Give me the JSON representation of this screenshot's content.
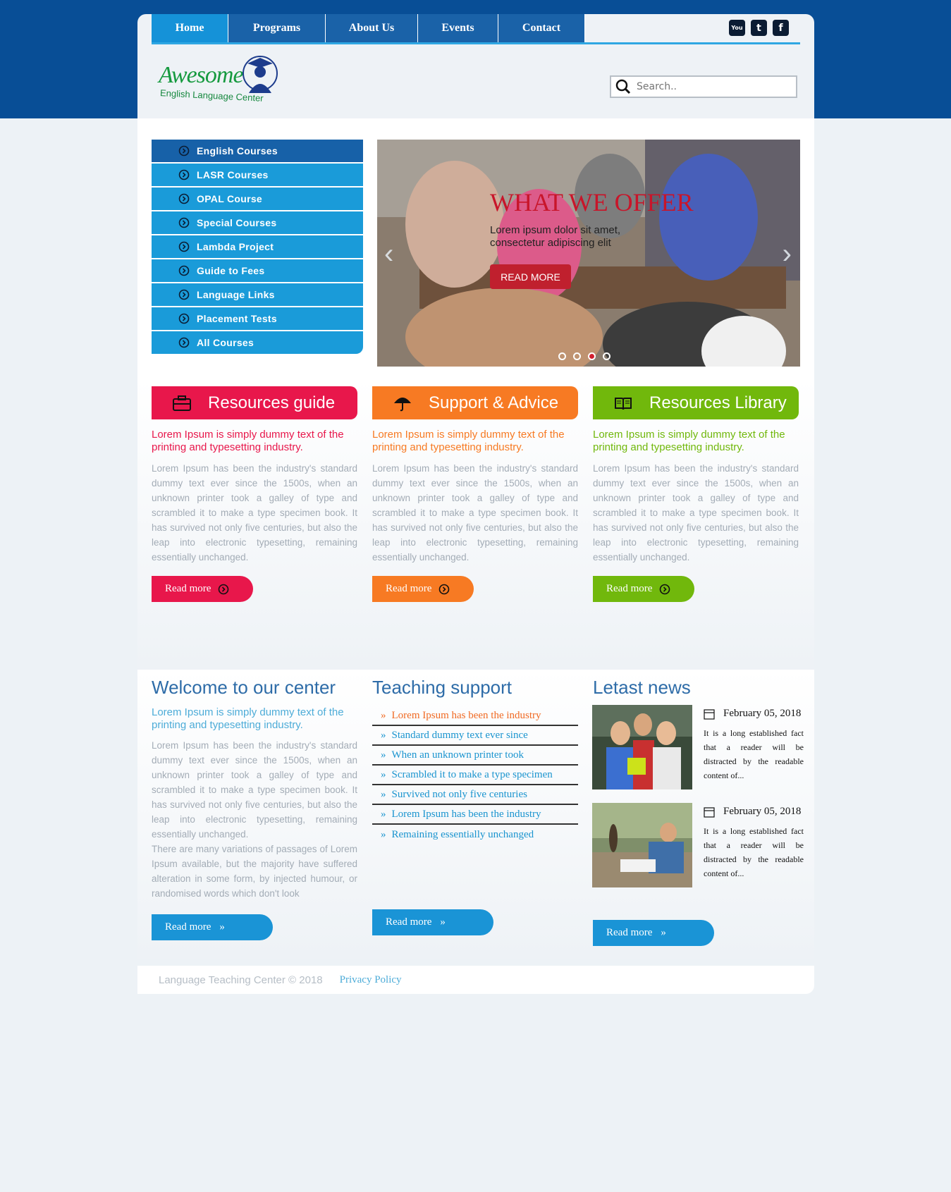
{
  "nav": {
    "items": [
      {
        "label": "Home"
      },
      {
        "label": "Programs"
      },
      {
        "label": "About Us"
      },
      {
        "label": "Events"
      },
      {
        "label": "Contact"
      }
    ],
    "social": [
      "youtube-icon",
      "twitter-icon",
      "facebook-icon"
    ],
    "youtube_label": "You",
    "twitter_label": "t",
    "facebook_label": "f"
  },
  "logo": {
    "word": "Awesome",
    "sub": "English Language Center"
  },
  "search": {
    "placeholder": "Search.."
  },
  "sidemenu": {
    "items": [
      {
        "label": "English Courses"
      },
      {
        "label": "LASR Courses"
      },
      {
        "label": "OPAL Course"
      },
      {
        "label": "Special Courses"
      },
      {
        "label": "Lambda Project"
      },
      {
        "label": "Guide to Fees"
      },
      {
        "label": "Language Links"
      },
      {
        "label": "Placement Tests"
      },
      {
        "label": "All Courses"
      }
    ]
  },
  "slider": {
    "title": "WHAT WE OFFER",
    "text": "Lorem ipsum dolor sit amet, consectetur adipiscing elit",
    "button": "READ MORE",
    "prev": "‹",
    "next": "›",
    "active_dot": 3,
    "dot_count": 4
  },
  "features": [
    {
      "title": "Resources guide",
      "icon": "briefcase-icon",
      "color": "#e8174b",
      "subtitle": "Lorem Ipsum is simply dummy text of the printing and typesetting industry.",
      "body": "Lorem Ipsum has been the industry's standard dummy text ever since the 1500s, when an unknown printer took a galley of type and scrambled it to make a type specimen book. It has survived not only five centuries, but also the leap into electronic typesetting, remaining essentially unchanged.",
      "button": "Read more"
    },
    {
      "title": "Support & Advice",
      "icon": "umbrella-icon",
      "color": "#f77a23",
      "subtitle": "Lorem Ipsum is simply dummy text of the printing and typesetting industry.",
      "body": "Lorem Ipsum has been the industry's standard dummy text ever since the 1500s, when an unknown printer took a galley of type and scrambled it to make a type specimen book. It has survived not only five centuries, but also the leap into electronic typesetting, remaining essentially unchanged.",
      "button": "Read more"
    },
    {
      "title": "Resources Library",
      "icon": "book-icon",
      "color": "#71b80c",
      "subtitle": "Lorem Ipsum is simply dummy text of the printing and typesetting industry.",
      "body": "Lorem Ipsum has been the industry's standard dummy text ever since the 1500s, when an unknown printer took a galley of type and scrambled it to make a type specimen book. It has survived not only five centuries, but also the leap into electronic typesetting, remaining essentially unchanged.",
      "button": "Read more"
    }
  ],
  "welcome": {
    "title": "Welcome to our center",
    "subtitle": "Lorem Ipsum is simply dummy text of the printing and typesetting industry.",
    "body1": "Lorem Ipsum has been the industry's standard dummy text ever since the 1500s, when an unknown printer took a galley of type and scrambled it to make a type specimen book. It has survived not only five centuries, but also the leap into electronic typesetting, remaining essentially unchanged.",
    "body2": "There are many variations of passages of Lorem Ipsum available, but the majority have suffered alteration in some form, by injected humour, or randomised words which don't look",
    "button": "Read more",
    "chevron": "»"
  },
  "teaching": {
    "title": "Teaching support",
    "chevron": "»",
    "links": [
      {
        "label": "Lorem Ipsum has been the industry"
      },
      {
        "label": "Standard dummy text ever since"
      },
      {
        "label": "When an unknown printer took"
      },
      {
        "label": "Scrambled it to make a type specimen"
      },
      {
        "label": "Survived not only five centuries"
      },
      {
        "label": "Lorem Ipsum has been the industry"
      },
      {
        "label": "Remaining essentially unchanged"
      }
    ],
    "button": "Read more"
  },
  "news": {
    "title": "Letast news",
    "items": [
      {
        "date": "February 05, 2018",
        "text": "It is a long established fact that a reader will be distracted by the readable content of..."
      },
      {
        "date": "February 05, 2018",
        "text": "It is a long established fact that a reader will be distracted by the readable content of..."
      }
    ],
    "button": "Read more"
  },
  "footer": {
    "copyright": "Language Teaching Center © 2018",
    "privacy": "Privacy Policy"
  },
  "colors": {
    "brand_dark": "#084e96",
    "nav": "#1a62a8",
    "menu": "#1a9bd9",
    "accent_red": "#c8152a"
  }
}
